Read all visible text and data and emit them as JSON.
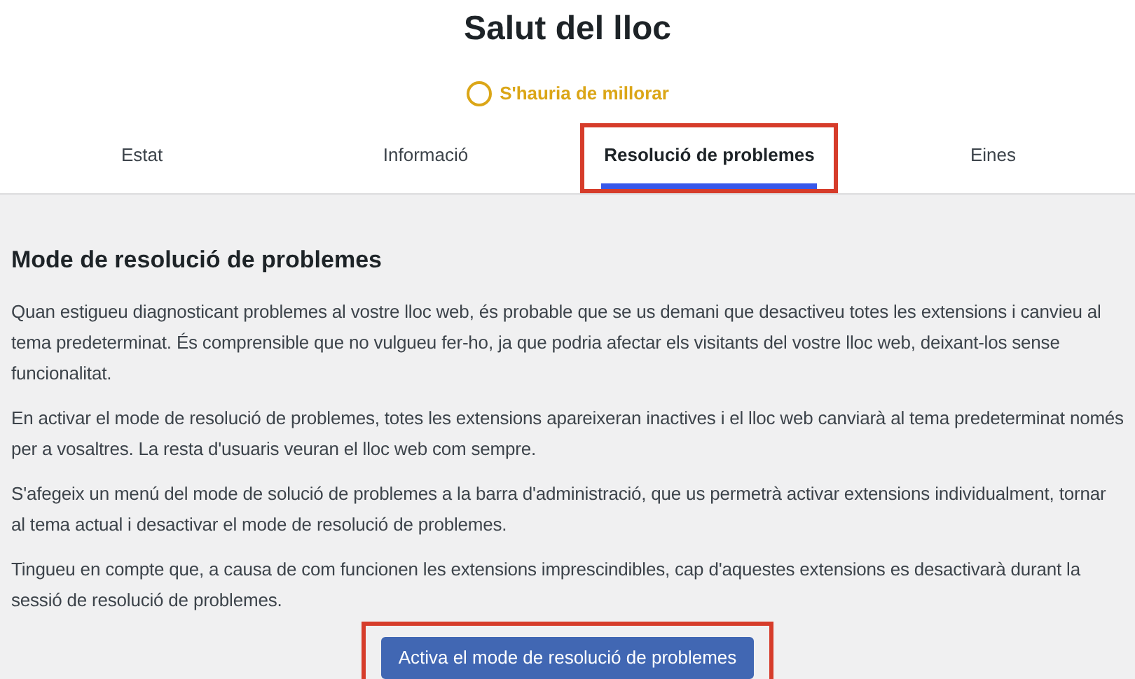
{
  "header": {
    "title": "Salut del lloc",
    "status": {
      "label": "S'hauria de millorar",
      "color": "#dba617"
    }
  },
  "tabs": [
    {
      "label": "Estat",
      "selected": false,
      "highlighted": false
    },
    {
      "label": "Informació",
      "selected": false,
      "highlighted": false
    },
    {
      "label": "Resolució de problemes",
      "selected": true,
      "highlighted": true
    },
    {
      "label": "Eines",
      "selected": false,
      "highlighted": false
    }
  ],
  "section": {
    "heading": "Mode de resolució de problemes",
    "paragraphs": [
      "Quan estigueu diagnosticant problemes al vostre lloc web, és probable que se us demani que desactiveu totes les extensions i canvieu al tema predeterminat. És comprensible que no vulgueu fer-ho, ja que podria afectar els visitants del vostre lloc web, deixant-los sense funcionalitat.",
      "En activar el mode de resolució de problemes, totes les extensions apareixeran inactives i el lloc web canviarà al tema predeterminat només per a vosaltres. La resta d'usuaris veuran el lloc web com sempre.",
      "S'afegeix un menú del mode de solució de problemes a la barra d'administració, que us permetrà activar extensions individualment, tornar al tema actual i desactivar el mode de resolució de problemes.",
      "Tingueu en compte que, a causa de com funcionen les extensions imprescindibles, cap d'aquestes extensions es desactivarà durant la sessió de resolució de problemes."
    ],
    "button": {
      "label": "Activa el mode de resolució de problemes",
      "highlighted": true
    }
  }
}
